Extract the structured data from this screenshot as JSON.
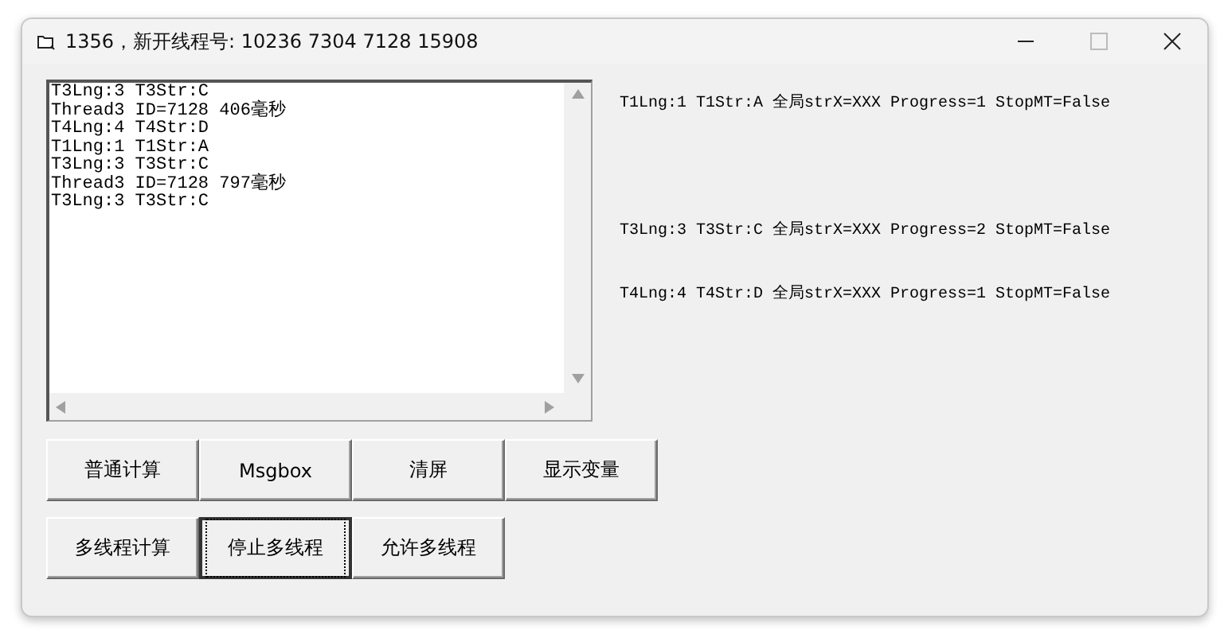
{
  "window": {
    "title": "1356，新开线程号: 10236 7304 7128 15908"
  },
  "log_box": {
    "lines": [
      "T3Lng:3 T3Str:C",
      "Thread3 ID=7128 406毫秒",
      "T4Lng:4 T4Str:D",
      "T1Lng:1 T1Str:A",
      "T3Lng:3 T3Str:C",
      "Thread3 ID=7128 797毫秒",
      "T3Lng:3 T3Str:C"
    ]
  },
  "status_labels": [
    {
      "text": "T1Lng:1 T1Str:A 全局strX=XXX Progress=1 StopMT=False"
    },
    {
      "text": "T3Lng:3 T3Str:C 全局strX=XXX Progress=2 StopMT=False"
    },
    {
      "text": "T4Lng:4 T4Str:D 全局strX=XXX Progress=1 StopMT=False"
    }
  ],
  "button_rows": [
    [
      {
        "label": "普通计算",
        "focused": false
      },
      {
        "label": "Msgbox",
        "focused": false
      },
      {
        "label": "清屏",
        "focused": false
      },
      {
        "label": "显示变量",
        "focused": false
      }
    ],
    [
      {
        "label": "多线程计算",
        "focused": false
      },
      {
        "label": "停止多线程",
        "focused": true
      },
      {
        "label": "允许多线程",
        "focused": false
      }
    ]
  ]
}
